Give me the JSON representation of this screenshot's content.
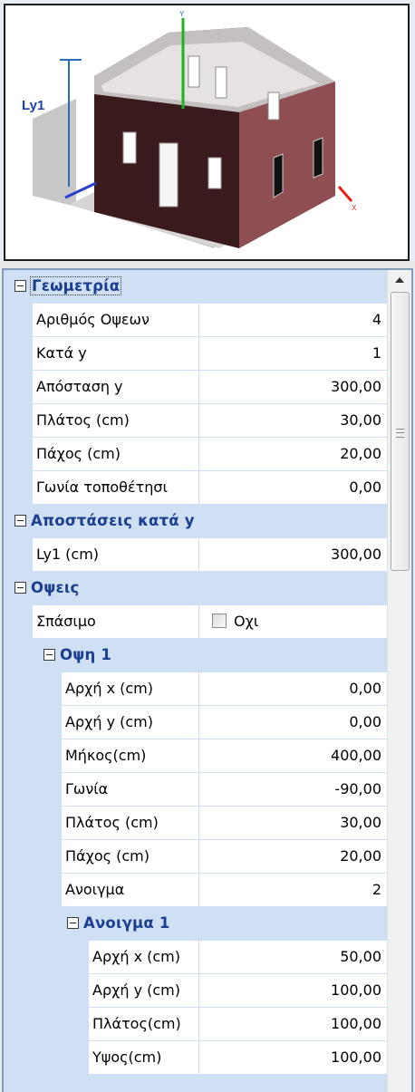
{
  "preview": {
    "axis_y": "Y",
    "axis_x": "X",
    "dimension_label": "Ly1"
  },
  "grid": {
    "rows": [
      {
        "type": "category",
        "level": 0,
        "label": "Γεωμετρία"
      },
      {
        "type": "property",
        "level": 0,
        "name": "Αριθμός Οψεων",
        "value": "4"
      },
      {
        "type": "property",
        "level": 0,
        "name": "Κατά y",
        "value": "1"
      },
      {
        "type": "property",
        "level": 0,
        "name": "Απόσταση y",
        "value": "300,00"
      },
      {
        "type": "property",
        "level": 0,
        "name": "Πλάτος (cm)",
        "value": "30,00"
      },
      {
        "type": "property",
        "level": 0,
        "name": "Πάχος (cm)",
        "value": "20,00"
      },
      {
        "type": "property",
        "level": 0,
        "name": "Γωνία τοποθέτησι",
        "value": "0,00"
      },
      {
        "type": "category",
        "level": 0,
        "label": "Αποστάσεις κατά y"
      },
      {
        "type": "property",
        "level": 0,
        "name": "Ly1 (cm)",
        "value": "300,00"
      },
      {
        "type": "category",
        "level": 0,
        "label": "Οψεις"
      },
      {
        "type": "checkbox",
        "level": 0,
        "name": "Σπάσιμο",
        "value": "Οχι"
      },
      {
        "type": "category",
        "level": 1,
        "label": "Οψη 1"
      },
      {
        "type": "property",
        "level": 1,
        "name": "Αρχή x (cm)",
        "value": "0,00"
      },
      {
        "type": "property",
        "level": 1,
        "name": "Αρχή y (cm)",
        "value": "0,00"
      },
      {
        "type": "property",
        "level": 1,
        "name": "Μήκος(cm)",
        "value": "400,00"
      },
      {
        "type": "property",
        "level": 1,
        "name": "Γωνία",
        "value": "-90,00"
      },
      {
        "type": "property",
        "level": 1,
        "name": "Πλάτος (cm)",
        "value": "30,00"
      },
      {
        "type": "property",
        "level": 1,
        "name": "Πάχος (cm)",
        "value": "20,00"
      },
      {
        "type": "property",
        "level": 1,
        "name": "Ανοιγμα",
        "value": "2"
      },
      {
        "type": "category",
        "level": 2,
        "label": "Ανοιγμα 1"
      },
      {
        "type": "property",
        "level": 2,
        "name": "Αρχή x (cm)",
        "value": "50,00"
      },
      {
        "type": "property",
        "level": 2,
        "name": "Αρχή y (cm)",
        "value": "100,00"
      },
      {
        "type": "property",
        "level": 2,
        "name": "Πλάτος(cm)",
        "value": "100,00"
      },
      {
        "type": "property",
        "level": 2,
        "name": "Υψος(cm)",
        "value": "100,00"
      }
    ]
  },
  "colors": {
    "category_bg": "#cfe0f5",
    "category_text": "#1b3f8e",
    "wall_front": "#3a1a1c",
    "wall_side": "#8f4e52"
  }
}
